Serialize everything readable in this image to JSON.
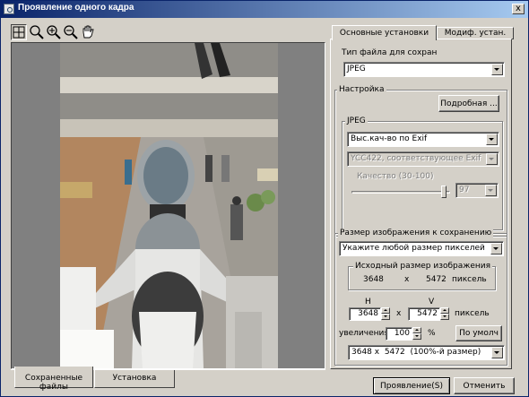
{
  "window": {
    "title": "Проявление одного кадра",
    "close_label": "x"
  },
  "toolbar": {
    "icons": [
      "fit-icon",
      "zoom-icon",
      "zoom-in-icon",
      "zoom-out-icon",
      "hand-icon"
    ]
  },
  "right_tabs": {
    "basic": "Основные установки",
    "modif": "Модиф. устан."
  },
  "file_type": {
    "label": "Тип файла для сохран",
    "value": "JPEG"
  },
  "settings": {
    "title": "Настройка",
    "detail_button": "Подробная ...",
    "jpeg": {
      "title": "JPEG",
      "quality_mode": "Выс.кач-во по Exif",
      "color_format": "YCC422, соответствующее Exif",
      "quality_label": "Качество (30-100)",
      "quality_value": "97",
      "quality_slider_fraction": 0.96
    }
  },
  "size": {
    "title": "Размер изображения к сохранению",
    "mode": "Укажите любой размер пикселей",
    "original": {
      "title": "Исходный размер изображения",
      "width": "3648",
      "x": "x",
      "height": "5472",
      "unit": "пиксель"
    },
    "h_label": "H",
    "v_label": "V",
    "h_value": "3648",
    "x": "x",
    "v_value": "5472",
    "unit": "пиксель",
    "zoom_label": "увеличения",
    "zoom_value": "100",
    "percent": "%",
    "default_button": "По умолч",
    "preset": "3648 x  5472  (100%-й размер)"
  },
  "bottom_tabs": {
    "saved": "Сохраненные файлы",
    "install": "Установка"
  },
  "buttons": {
    "develop": "Проявление(S)",
    "cancel": "Отменить"
  }
}
